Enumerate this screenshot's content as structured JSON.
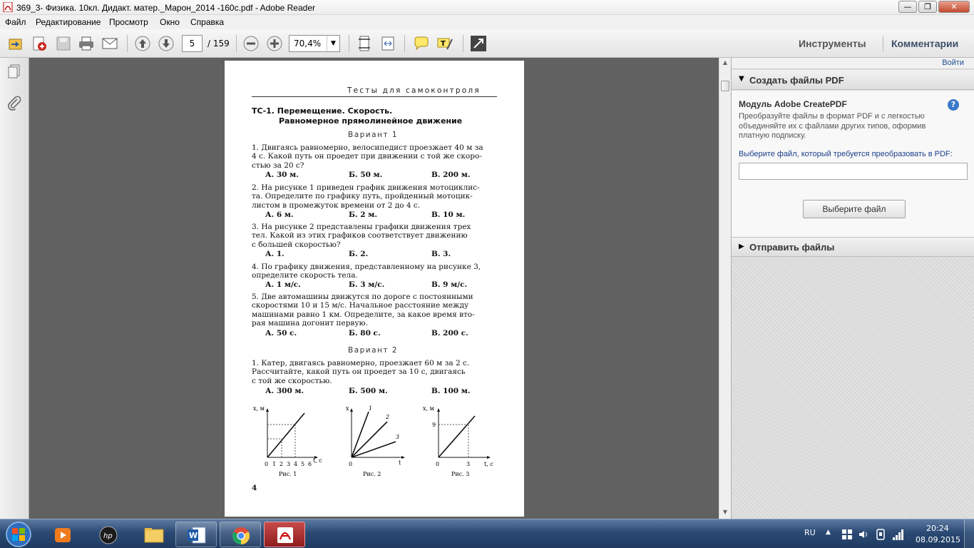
{
  "window": {
    "title": "369_3- Физика. 10кл. Дидакт. матер._Марон_2014 -160с.pdf - Adobe Reader"
  },
  "menu": {
    "file": "Файл",
    "edit": "Редактирование",
    "view": "Просмотр",
    "window": "Окно",
    "help": "Справка"
  },
  "toolbar": {
    "page_current": "5",
    "page_total": "/ 159",
    "zoom": "70,4%",
    "tools_tab": "Инструменты",
    "comments_tab": "Комментарии"
  },
  "panel": {
    "signin": "Войти",
    "create_header": "Создать файлы PDF",
    "module_title": "Модуль Adobe CreatePDF",
    "module_desc": "Преобразуйте файлы в формат PDF и с легкостью объединяйте их с файлами других типов, оформив платную подписку.",
    "select_prompt": "Выберите файл, который требуется преобразовать в PDF:",
    "select_button": "Выберите файл",
    "send_header": "Отправить файлы"
  },
  "doc": {
    "running_head": "Тесты для самоконтроля",
    "heading1": "ТС-1. Перемещение. Скорость.",
    "heading2": "Равномерное прямолинейное движение",
    "variant1": "Вариант 1",
    "q1": [
      "1. Двигаясь равномерно, велосипедист проезжает 40 м за",
      "4 с. Какой путь он проедет при движении с той же скоро-",
      "стью за 20 с?"
    ],
    "q1_ans": [
      "А. 30 м.",
      "Б. 50 м.",
      "В. 200 м."
    ],
    "q2": [
      "2. На рисунке 1 приведен график движения мотоциклис-",
      "та. Определите по графику путь, пройденный мотоцик-",
      "листом в промежуток времени от 2 до 4 с."
    ],
    "q2_ans": [
      "А. 6 м.",
      "Б. 2 м.",
      "В. 10 м."
    ],
    "q3": [
      "3. На рисунке 2 представлены графики движения трех",
      "тел. Какой из этих графиков соответствует движению",
      "с большей скоростью?"
    ],
    "q3_ans": [
      "А. 1.",
      "Б. 2.",
      "В. 3."
    ],
    "q4": [
      "4. По графику движения, представленному на рисунке 3,",
      "определите скорость тела."
    ],
    "q4_ans": [
      "А. 1 м/с.",
      "Б. 3 м/с.",
      "В. 9 м/с."
    ],
    "q5": [
      "5. Две автомашины движутся по дороге с постоянными",
      "скоростями 10 и 15 м/с. Начальное расстояние между",
      "машинами равно 1 км. Определите, за какое время вто-",
      "рая машина догонит первую."
    ],
    "q5_ans": [
      "А. 50 с.",
      "Б. 80 с.",
      "В. 200 с."
    ],
    "variant2": "Вариант 2",
    "v2q1": [
      "1. Катер, двигаясь равномерно, проезжает 60 м за 2 с.",
      "Рассчитайте, какой путь он проедет за 10 с, двигаясь",
      "с той же скоростью."
    ],
    "v2q1_ans": [
      "А. 300 м.",
      "Б. 500 м.",
      "В. 100 м."
    ],
    "fig1": {
      "ylabel": "x, м",
      "xlabel": "t, с",
      "ticks": [
        "0",
        "1",
        "2",
        "3",
        "4",
        "5",
        "6"
      ],
      "caption": "Рис. 1"
    },
    "fig2": {
      "ylabel": "x",
      "xlabel": "t",
      "origin": "0",
      "lines": [
        "1",
        "2",
        "3"
      ],
      "caption": "Рис. 2"
    },
    "fig3": {
      "ylabel": "x, м",
      "xlabel": "t, с",
      "ytick": "9",
      "xticks": [
        "0",
        "3"
      ],
      "caption": "Рис. 3"
    },
    "page_number": "4"
  },
  "taskbar": {
    "lang": "RU",
    "time": "20:24",
    "date": "08.09.2015"
  }
}
